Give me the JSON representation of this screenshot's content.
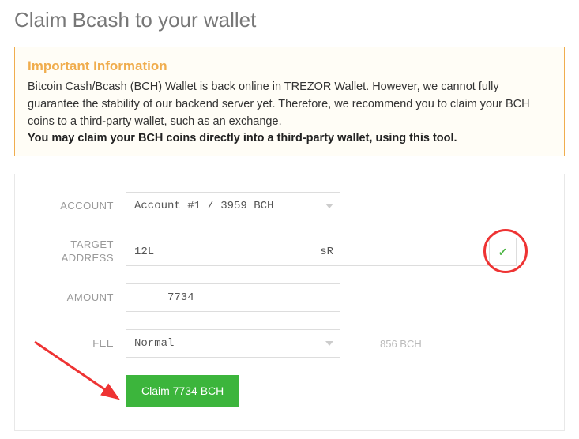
{
  "page": {
    "title": "Claim Bcash to your wallet"
  },
  "info": {
    "heading": "Important Information",
    "body": "Bitcoin Cash/Bcash (BCH) Wallet is back online in TREZOR Wallet. However, we cannot fully guarantee the stability of our backend server yet. Therefore, we recommend you to claim your BCH coins to a third-party wallet, such as an exchange.",
    "bold": "You may claim your BCH coins directly into a third-party wallet, using this tool."
  },
  "form": {
    "account_label": "ACCOUNT",
    "account_value": "Account #1 /       3959 BCH",
    "target_label": "TARGET ADDRESS",
    "target_value": "12L                         sR",
    "amount_label": "AMOUNT",
    "amount_value": "     7734",
    "fee_label": "FEE",
    "fee_value": "Normal",
    "fee_side": "856 BCH",
    "claim_button": "Claim       7734 BCH"
  }
}
